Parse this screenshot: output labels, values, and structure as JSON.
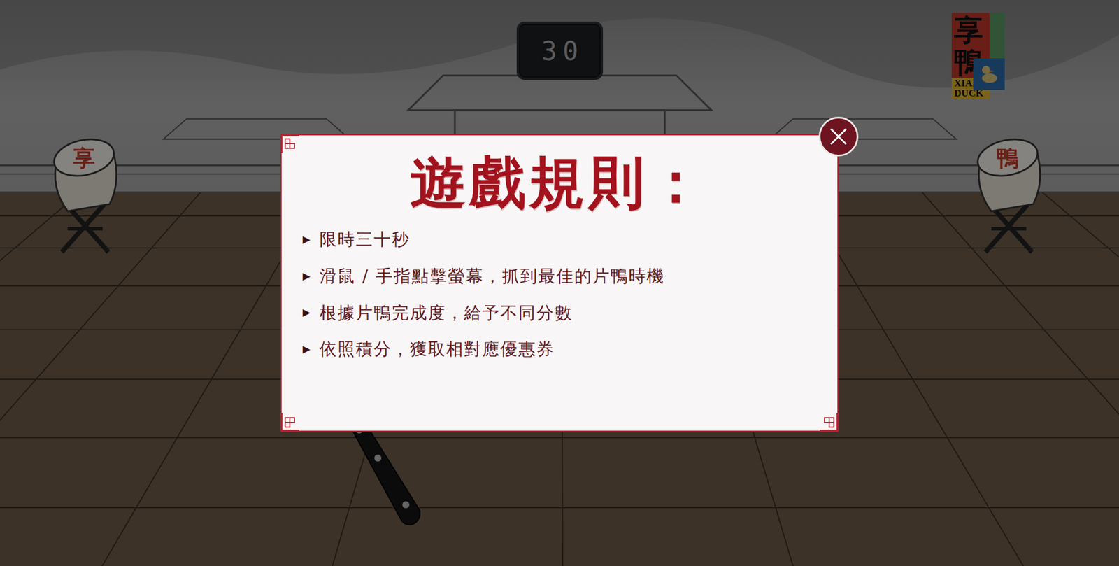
{
  "timer": "30",
  "logo": {
    "name": "享鴨",
    "latin": [
      "XIANG",
      "DUCK"
    ]
  },
  "drums": [
    {
      "label": "享",
      "side": "left"
    },
    {
      "label": "鴨",
      "side": "right"
    }
  ],
  "dialog": {
    "title": "遊戲規則：",
    "bullet": "▶",
    "rules": [
      "限時三十秒",
      "滑鼠 / 手指點擊螢幕，抓到最佳的片鴨時機",
      "根據片鴨完成度，給予不同分數",
      "依照積分，獲取相對應優惠券"
    ]
  }
}
